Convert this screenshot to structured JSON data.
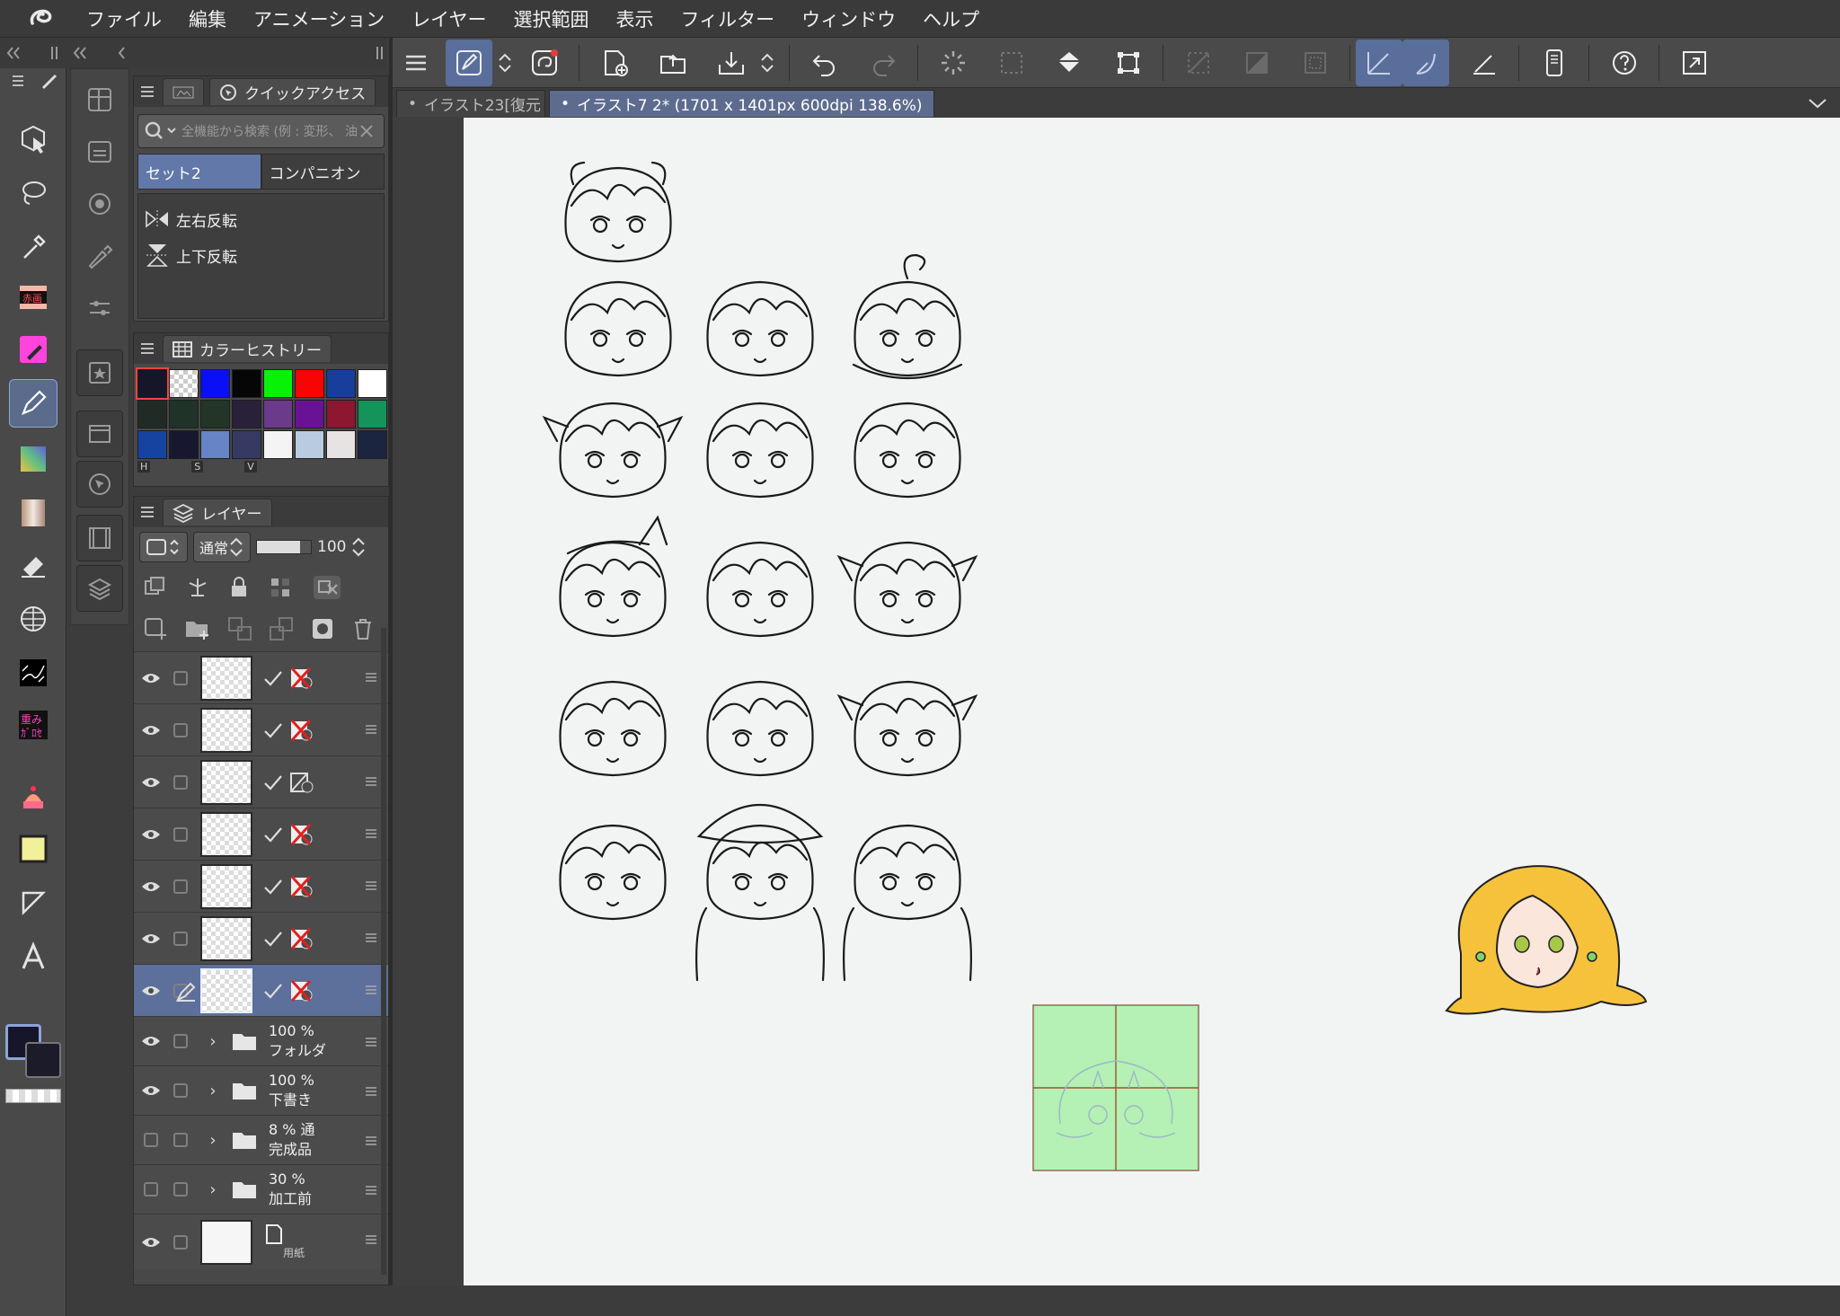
{
  "menubar": {
    "items": [
      "ファイル",
      "編集",
      "アニメーション",
      "レイヤー",
      "選択範囲",
      "表示",
      "フィルター",
      "ウィンドウ",
      "ヘルプ"
    ]
  },
  "quick_access": {
    "tab_label": "クイックアクセス",
    "search_placeholder": "全機能から検索 (例 : 変形、 油彩",
    "sets": [
      "セット2",
      "コンパニオン"
    ],
    "items": [
      {
        "label": "左右反転",
        "icon": "flip-horizontal-icon"
      },
      {
        "label": "上下反転",
        "icon": "flip-vertical-icon"
      }
    ]
  },
  "color_history": {
    "tab_label": "カラーヒストリー",
    "colors": [
      "#16152a",
      "checker",
      "#0a0ff5",
      "#060606",
      "#07f207",
      "#f70505",
      "#163e9a",
      "#ffffff",
      "#212b25",
      "#1f3328",
      "#223526",
      "#29213a",
      "#6b3a8a",
      "#6a1296",
      "#8d1630",
      "#14945a",
      "#1643a0",
      "#171730",
      "#6785c6",
      "#363a62",
      "#f4f4f4",
      "#b9cbe0",
      "#e7e3e3",
      "#1b2540"
    ],
    "hsv_labels": [
      "H",
      "S",
      "V"
    ]
  },
  "layer_panel": {
    "tab_label": "レイヤー",
    "blend_mode": "通常",
    "opacity": "100",
    "layers": [
      {
        "type": "raster",
        "name": "",
        "visible": true
      },
      {
        "type": "raster",
        "name": "",
        "visible": true
      },
      {
        "type": "raster",
        "name": "",
        "visible": true
      },
      {
        "type": "raster",
        "name": "",
        "visible": true
      },
      {
        "type": "raster",
        "name": "",
        "visible": true
      },
      {
        "type": "raster",
        "name": "",
        "visible": true
      },
      {
        "type": "raster",
        "name": "",
        "visible": true,
        "selected": true
      },
      {
        "type": "folder",
        "opacity": "100 %",
        "name": "フォルダ",
        "visible": true
      },
      {
        "type": "folder",
        "opacity": "100 %",
        "name": "下書き",
        "visible": true
      },
      {
        "type": "folder",
        "opacity": "8 % 通",
        "name": "完成品",
        "visible": false
      },
      {
        "type": "folder",
        "opacity": "30 % ",
        "name": "加工前",
        "visible": false
      },
      {
        "type": "paper",
        "name": "用紙",
        "visible": true
      }
    ]
  },
  "document_tabs": [
    {
      "label": "イラスト23[復元",
      "active": false
    },
    {
      "label": "イラスト7 2* (1701 x 1401px 600dpi 138.6%)",
      "active": true
    }
  ],
  "colors": {
    "accent": "#5d6f9b",
    "main_color": "#16152a",
    "sub_color": "#1b1b2a",
    "canvas_bg": "#f2f4f3",
    "green_box": "#b5f0b4"
  }
}
